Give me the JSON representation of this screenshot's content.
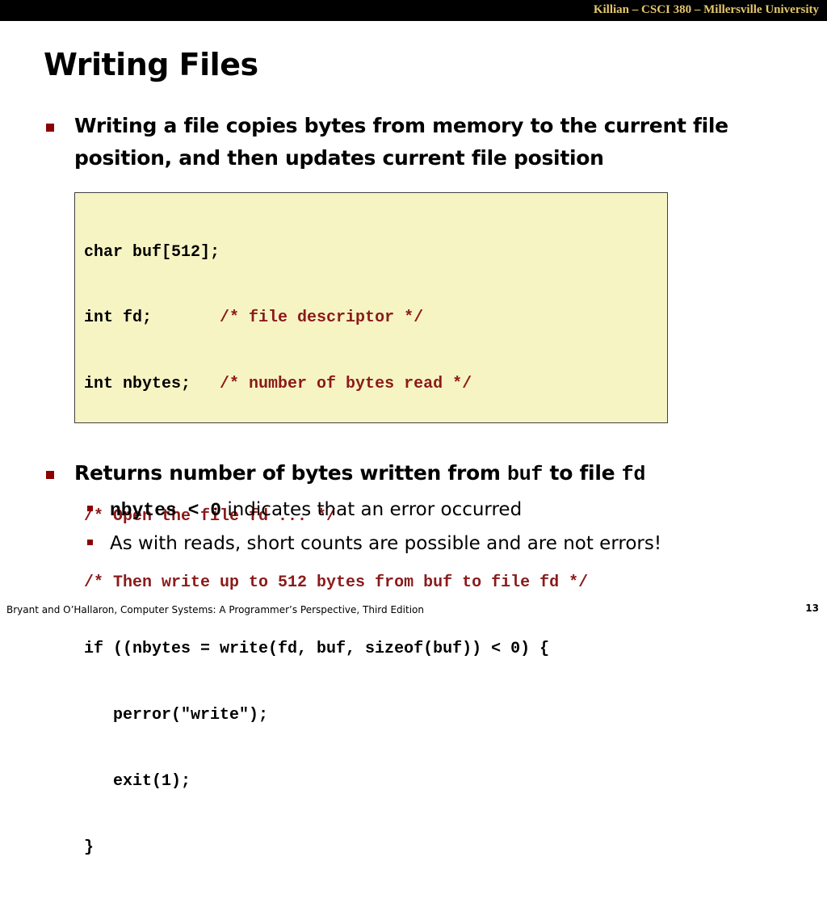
{
  "header": {
    "course": "Killian – CSCI 380 – Millersville University"
  },
  "slide": {
    "title": "Writing Files",
    "bullet1": "Writing a file copies bytes from memory to the current file position, and then updates current file position",
    "code": {
      "l1": "char buf[512];",
      "l2a": "int fd;       ",
      "l2b": "/* file descriptor */",
      "l3a": "int nbytes;   ",
      "l3b": "/* number of bytes read */",
      "l4": "/* Open the file fd ... */",
      "l5": "/* Then write up to 512 bytes from buf to file fd */",
      "l6": "if ((nbytes = write(fd, buf, sizeof(buf)) < 0) {",
      "l7": "   perror(\"write\");",
      "l8": "   exit(1);",
      "l9": "}"
    },
    "bullet2": {
      "text_a": "Returns number of bytes written from ",
      "code_a": "buf",
      "text_b": " to file ",
      "code_b": "fd"
    },
    "sub1": {
      "code": "nbytes < 0",
      "text": " indicates that an error occurred"
    },
    "sub2": "As with reads, short counts are possible and are not errors!"
  },
  "footer": {
    "citation": "Bryant and O’Hallaron, Computer Systems: A Programmer’s Perspective, Third Edition",
    "page": "13"
  },
  "colors": {
    "accent": "#8b0000",
    "code_bg": "#f7f4c4",
    "comment": "#8b1a1a",
    "header_text": "#e6c76a"
  }
}
